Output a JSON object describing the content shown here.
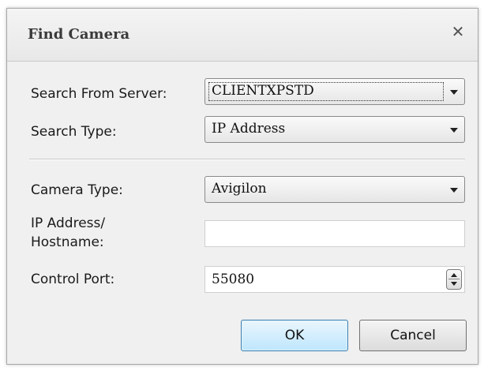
{
  "dialog": {
    "title": "Find Camera",
    "close_icon": "close-icon"
  },
  "form": {
    "search_from_server": {
      "label": "Search From Server:",
      "value": "CLIENTXPSTD"
    },
    "search_type": {
      "label": "Search Type:",
      "value": "IP Address"
    },
    "camera_type": {
      "label": "Camera Type:",
      "value": "Avigilon"
    },
    "ip_address": {
      "label_line1": "IP Address/",
      "label_line2": "Hostname:",
      "value": ""
    },
    "control_port": {
      "label": "Control Port:",
      "value": "55080"
    }
  },
  "buttons": {
    "ok": "OK",
    "cancel": "Cancel"
  },
  "colors": {
    "ok_border": "#3c7fb1",
    "dialog_bg": "#f0f0f0"
  }
}
